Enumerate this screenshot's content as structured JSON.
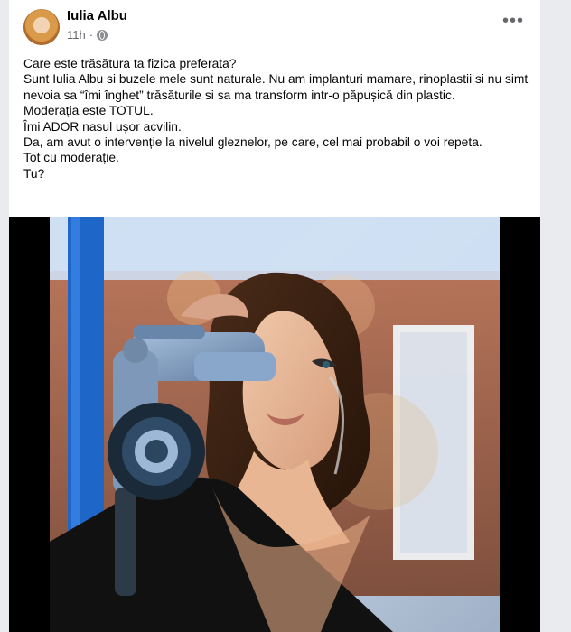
{
  "post": {
    "author": "Iulia Albu",
    "time": "11h",
    "privacy_icon": "globe-icon",
    "more_icon": "more-horizontal-icon",
    "lines": [
      "Care este trăsătura ta fizica preferata?",
      "Sunt Iulia Albu si buzele mele sunt naturale. Nu am implanturi mamare, rinoplastii si nu simt nevoia sa “îmi înghet” trăsăturile si sa ma transform intr-o păpușică din plastic.",
      "Moderația este TOTUL.",
      "Îmi ADOR nasul ușor acvilin.",
      "Da, am avut o intervenție la nivelul gleznelor, pe care, cel mai probabil o voi repeta.",
      "Tot cu moderație.",
      "Tu?"
    ]
  },
  "colors": {
    "background": "#e9ebee",
    "card": "#ffffff",
    "text": "#050505",
    "secondary_text": "#65676b"
  }
}
